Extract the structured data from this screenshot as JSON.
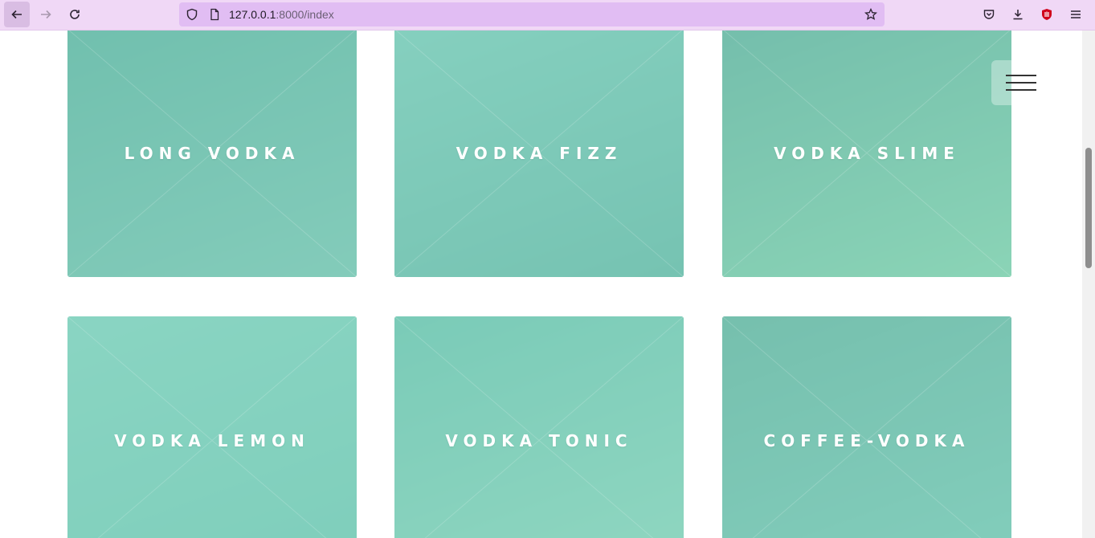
{
  "browser": {
    "url_host": "127.0.0.1",
    "url_rest": ":8000/index"
  },
  "cards": [
    {
      "title": "LONG VODKA",
      "bg1": "#5e8f86",
      "bg2": "#9fb9b0"
    },
    {
      "title": "VODKA FIZZ",
      "bg1": "#a5c7c0",
      "bg2": "#6f9a93"
    },
    {
      "title": "VODKA SLIME",
      "bg1": "#6a8a7e",
      "bg2": "#b9d7a2"
    },
    {
      "title": "VODKA LEMON",
      "bg1": "#b6d9cd",
      "bg2": "#8fc3b5"
    },
    {
      "title": "VODKA TONIC",
      "bg1": "#7fb6a8",
      "bg2": "#c9dfc6"
    },
    {
      "title": "COFFEE-VODKA",
      "bg1": "#6f8e84",
      "bg2": "#9cc0b6"
    }
  ],
  "colors": {
    "overlay": "#78d2be",
    "toolbar": "#f0d8f6",
    "urlbar": "#e1bdf3"
  }
}
